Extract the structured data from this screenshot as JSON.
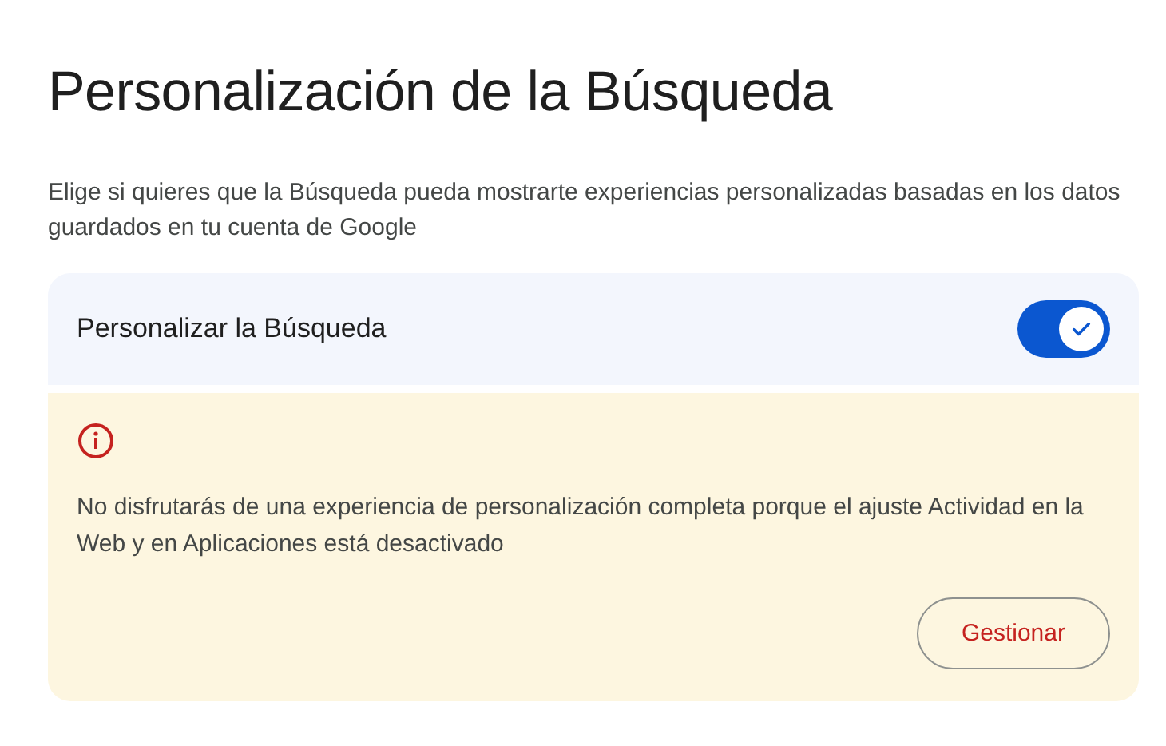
{
  "page_title": "Personalización de la Búsqueda",
  "description": "Elige si quieres que la Búsqueda pueda mostrarte experiencias personalizadas basadas en los datos guardados en tu cuenta de Google",
  "setting": {
    "label": "Personalizar la Búsqueda",
    "on": true
  },
  "warning": {
    "message": "No disfrutarás de una experiencia de personalización completa porque el ajuste Actividad en la Web y en Aplicaciones está desactivado",
    "button": "Gestionar"
  }
}
